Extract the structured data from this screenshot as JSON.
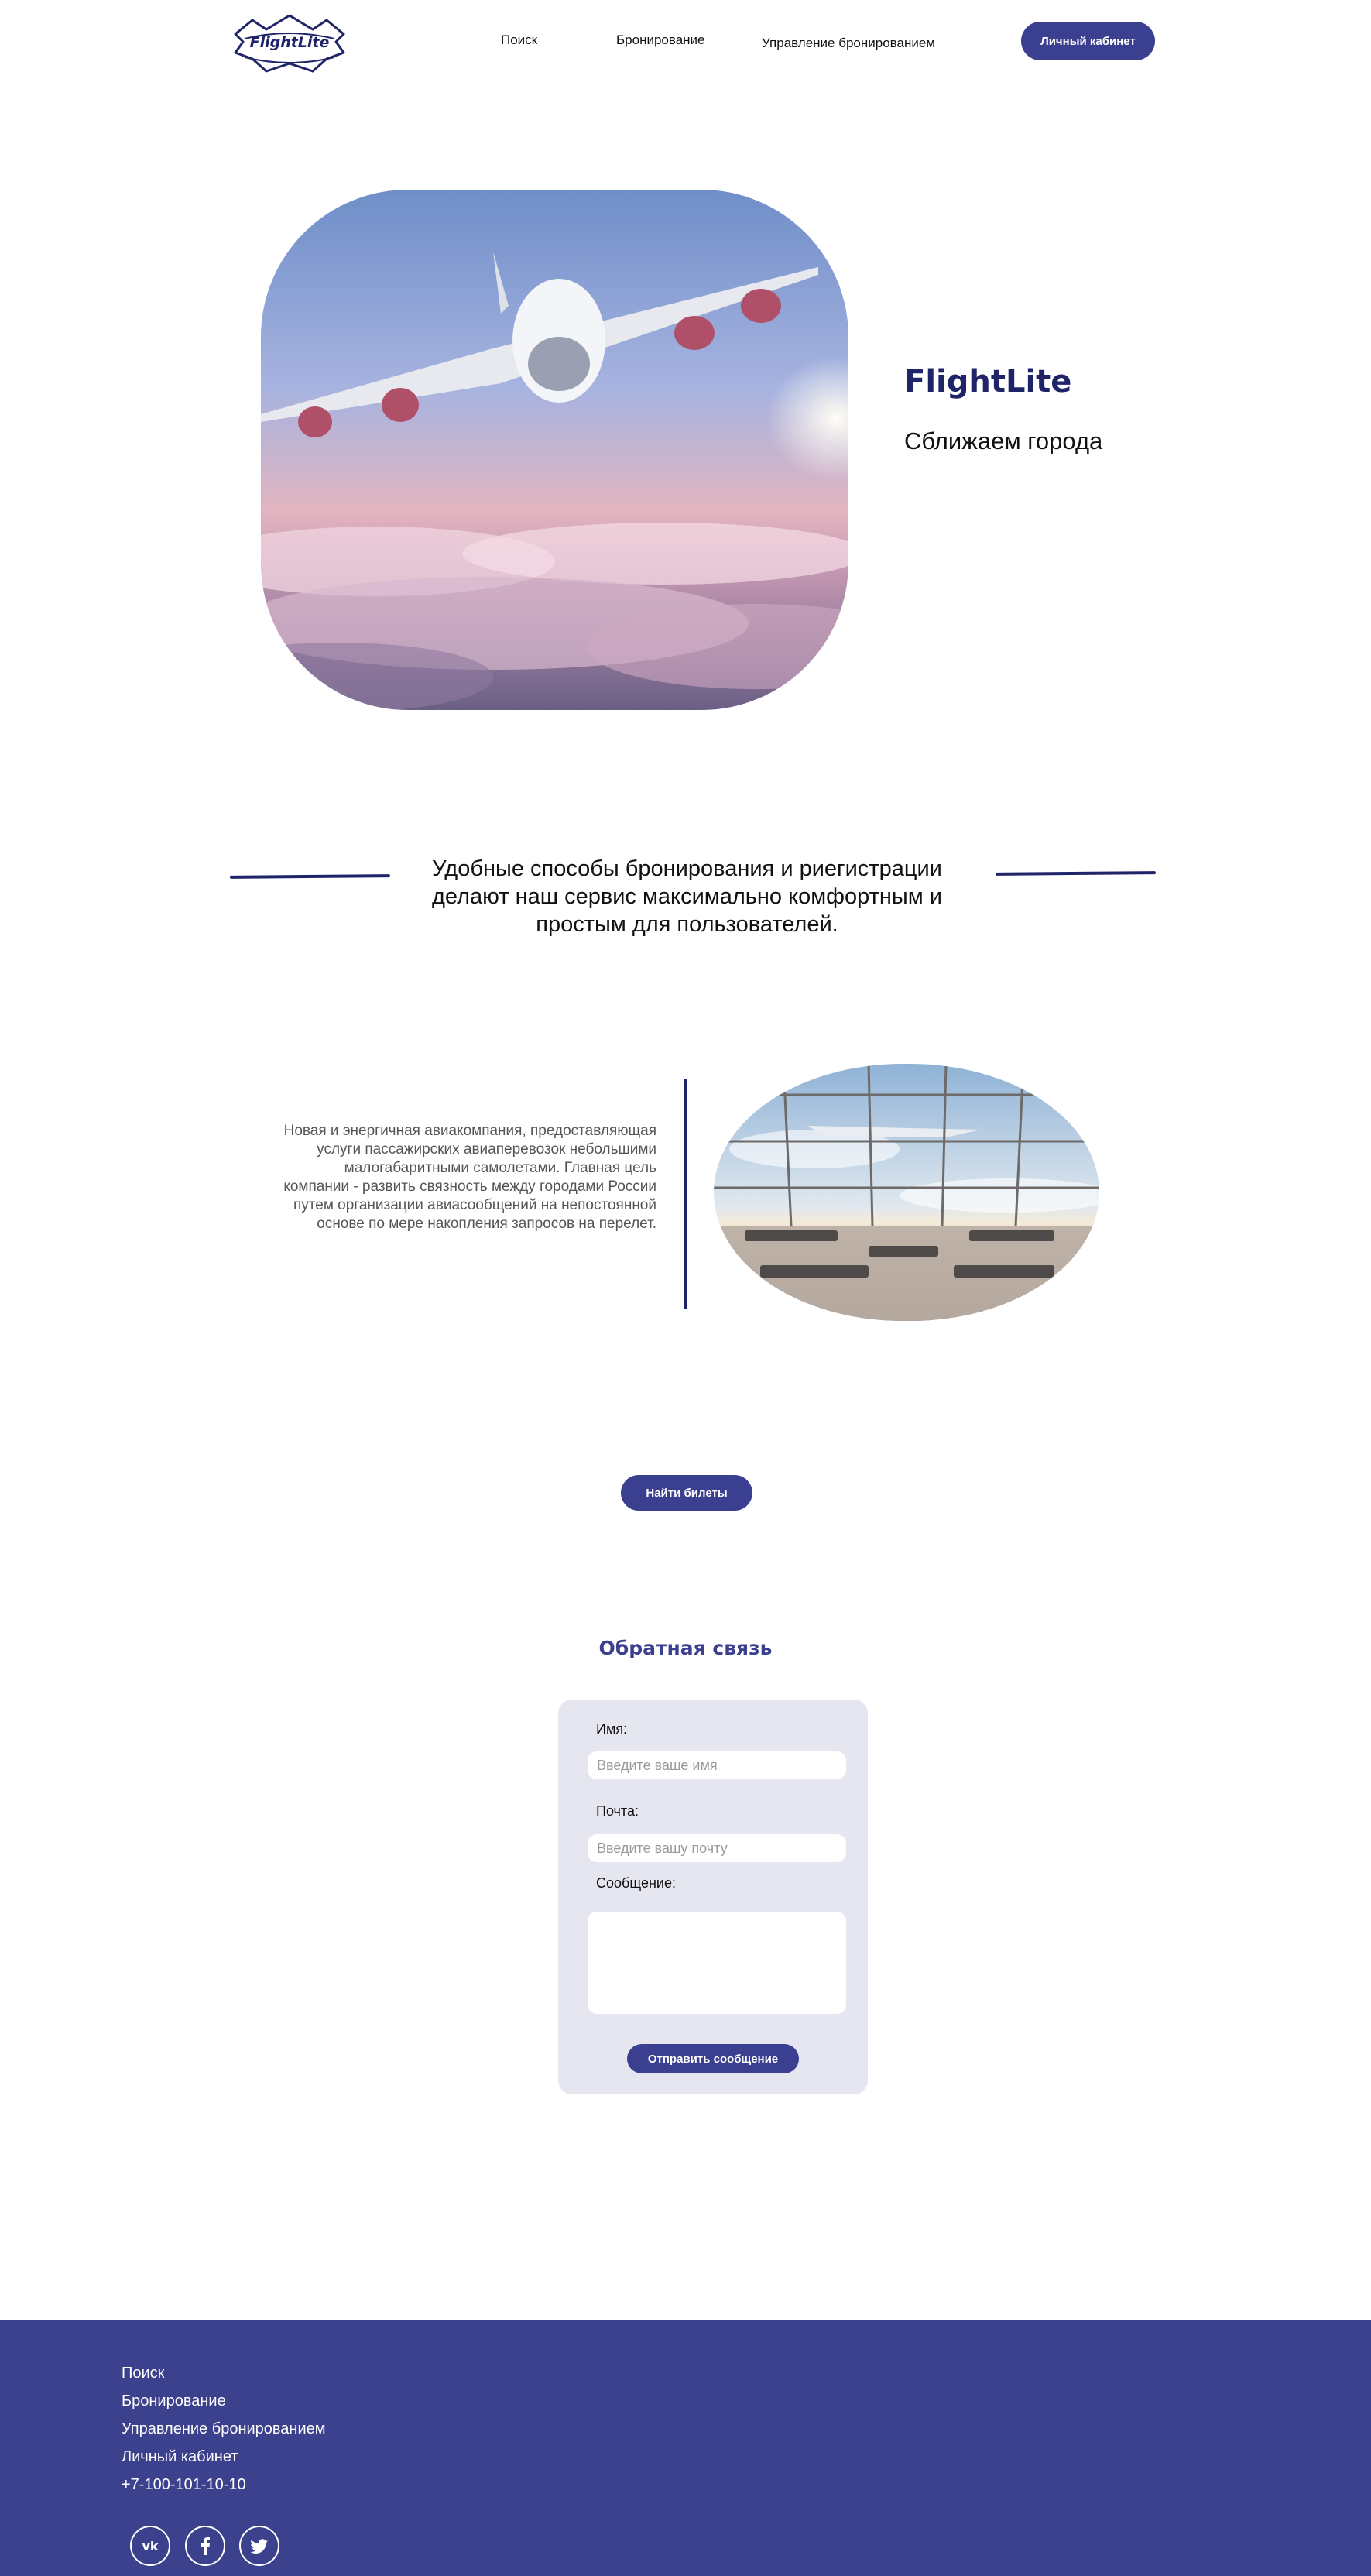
{
  "header": {
    "logo_text": "FlightLite",
    "nav": [
      "Поиск",
      "Бронирование",
      "Управление бронированием"
    ],
    "account_button": "Личный кабинет"
  },
  "hero": {
    "title": "FlightLite",
    "subtitle": "Сближаем города"
  },
  "tagline": "Удобные способы бронирования и риегистрации делают наш сервис максимально комфортным и простым для пользователей.",
  "about": {
    "text": "Новая и энергичная авиакомпания, предоставляющая услуги пассажирских авиаперевозок небольшими малогабаритными самолетами. Главная цель компании - развить связность между городами России путем организации авиасообщений на непостоянной основе по мере накопления запросов на перелет."
  },
  "cta_button": "Найти билеты",
  "feedback": {
    "title": "Обратная связь",
    "name_label": "Имя:",
    "name_placeholder": "Введите ваше имя",
    "email_label": "Почта:",
    "email_placeholder": "Введите вашу почту",
    "message_label": "Сообщение:",
    "submit_button": "Отправить сообщение"
  },
  "footer": {
    "links": [
      "Поиск",
      "Бронирование",
      "Управление бронированием",
      "Личный кабинет"
    ],
    "phone": "+7-100-101-10-10",
    "social_icons": [
      "vk-icon",
      "facebook-icon",
      "twitter-icon"
    ]
  },
  "colors": {
    "brand_dark": "#1f2468",
    "brand": "#3b3f8f",
    "footer_bg": "#3b418d",
    "card_bg": "#e6e6f1"
  }
}
